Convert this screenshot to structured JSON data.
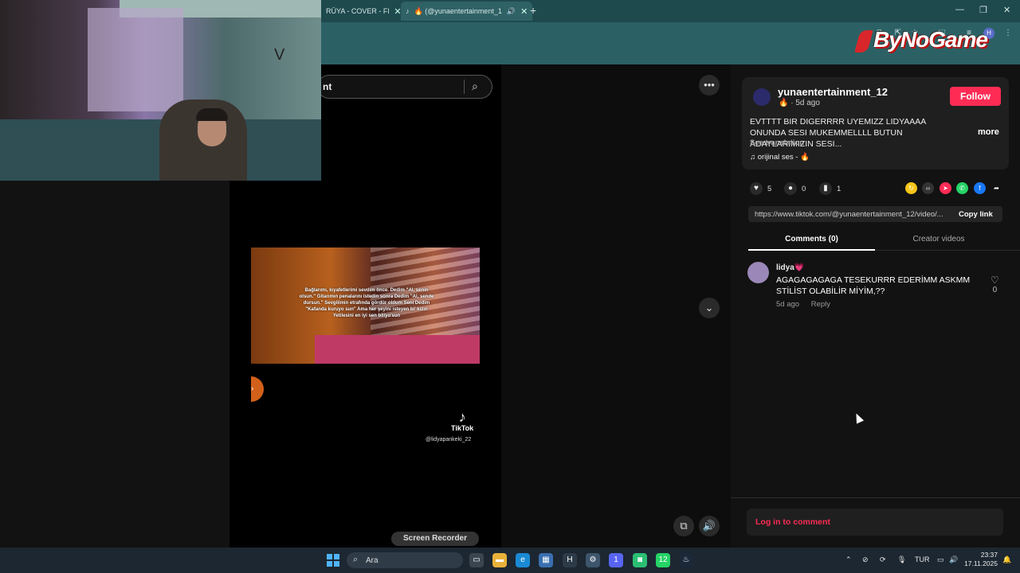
{
  "browser": {
    "tabs": [
      {
        "label": "RÜYA - COVER - Fl",
        "close": "✕"
      },
      {
        "label": "🔥 (@yunaentertainment_1",
        "close": "✕"
      }
    ],
    "new_tab": "+",
    "window_controls": [
      "—",
      "❐",
      "✕"
    ],
    "profile_initial": "H",
    "overlay_logo": "ByNoGame"
  },
  "webcam": {
    "wall_text": "V"
  },
  "video": {
    "search_text": "nt",
    "thumbnail_caption": "Bağlarımı, kıyafetlerimi sevdim önce. Dedim \"Al, senin olsun.\" Gitarımın penalarını istedin sonra Dedim \"Al, sende dursun.\" Sevgilimin etrafında gördür oldum Seni Dedim \"Kafanda kuruyo sun\" Ama her şeyini isteyen bi' kızın Yetilesini en iyi sen biliyo'sun",
    "watermark": "TikTok",
    "watermark_handle": "@lidyapankeki_22",
    "screen_recorder": "Screen Recorder",
    "more_icon": "•••",
    "down_icon": "⌄",
    "volume_icon": "🔊",
    "pip_icon": "⧉"
  },
  "post": {
    "account": "yunaentertainment_12",
    "meta": "🔥 · 5d ago",
    "follow_label": "Follow",
    "description": "EVTTTT BIR DIGERRRR UYEMIZZ LIDYAAAA ONUNDA SESI MUKEMMELLLL BUTUN ADAYLARIMIZIN SESI...",
    "more_label": "more",
    "see_translation": "See translation",
    "sound": "♫  orijinal ses - 🔥",
    "likes": "5",
    "comments": "0",
    "saves": "1",
    "link": "https://www.tiktok.com/@yunaentertainment_12/video/...",
    "copy_link": "Copy link",
    "tab_comments": "Comments (0)",
    "tab_creator": "Creator videos"
  },
  "comment": {
    "user": "lidya💗",
    "text": "AGAGAGAGAGA TESEKURRR EDERİMM ASKMM STİLİST OLABİLİR MİYİM,??",
    "time": "5d ago",
    "reply": "Reply",
    "likes": "0"
  },
  "login_prompt": "Log in to comment",
  "taskbar": {
    "search_placeholder": "Ara",
    "language": "TUR",
    "time": "23:37",
    "date": "17.11.2025",
    "badges": {
      "chrome": "H",
      "discord": "1",
      "whatsapp": "12"
    }
  },
  "colors": {
    "accent": "#fe2c55",
    "taskbar": "#1c2731",
    "browser_tabbar": "#1e4a4d"
  }
}
